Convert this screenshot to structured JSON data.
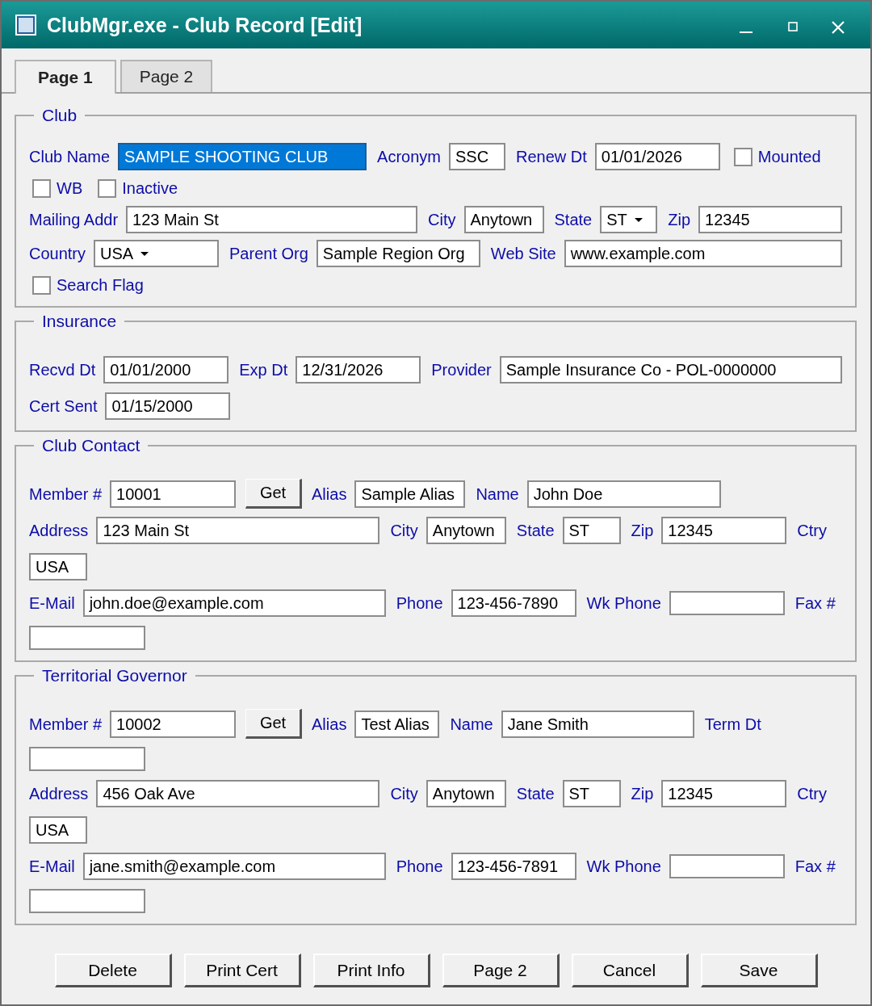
{
  "window": {
    "title": "ClubMgr.exe - Club Record [Edit]"
  },
  "tabs": [
    {
      "label": "Page 1",
      "selected": true
    },
    {
      "label": "Page 2",
      "selected": false
    }
  ],
  "sections": [
    {
      "title": "Club",
      "rows": [
        {
          "items": [
            {
              "kind": "label",
              "text": "Club Name"
            },
            {
              "kind": "field",
              "value": "SAMPLE SHOOTING CLUB",
              "focused": true
            },
            {
              "kind": "label",
              "text": "Acronym"
            },
            {
              "kind": "field",
              "value": "SSC",
              "focused": false
            },
            {
              "kind": "label",
              "text": "Renew Dt"
            },
            {
              "kind": "field",
              "value": "01/01/2026",
              "focused": false
            },
            {
              "kind": "checkbox",
              "label": "Mounted",
              "checked": false
            }
          ]
        },
        {
          "items": [
            {
              "kind": "checkbox",
              "label": "WB",
              "checked": false
            },
            {
              "kind": "checkbox",
              "label": "Inactive",
              "checked": false
            }
          ]
        },
        {
          "items": [
            {
              "kind": "label",
              "text": "Mailing Addr"
            },
            {
              "kind": "field",
              "value": "123 Main St",
              "focused": false
            },
            {
              "kind": "label",
              "text": "City"
            },
            {
              "kind": "field",
              "value": "Anytown",
              "focused": false
            },
            {
              "kind": "label",
              "text": "State"
            },
            {
              "kind": "dropdown",
              "value": "ST",
              "focused": false
            },
            {
              "kind": "label",
              "text": "Zip"
            },
            {
              "kind": "field",
              "value": "12345",
              "focused": false
            }
          ]
        },
        {
          "items": [
            {
              "kind": "label",
              "text": "Country"
            },
            {
              "kind": "dropdown",
              "value": "USA",
              "focused": false
            },
            {
              "kind": "label",
              "text": "Parent Org"
            },
            {
              "kind": "field",
              "value": "Sample Region Org",
              "focused": false
            },
            {
              "kind": "label",
              "text": "Web Site"
            },
            {
              "kind": "field",
              "value": "www.example.com",
              "focused": false
            }
          ]
        },
        {
          "items": [
            {
              "kind": "checkbox",
              "label": "Search Flag",
              "checked": false
            }
          ]
        }
      ]
    },
    {
      "title": "Insurance",
      "rows": [
        {
          "items": [
            {
              "kind": "label",
              "text": "Recvd Dt"
            },
            {
              "kind": "field",
              "value": "01/01/2000",
              "focused": false
            },
            {
              "kind": "label",
              "text": "Exp Dt"
            },
            {
              "kind": "field",
              "value": "12/31/2026",
              "focused": false
            },
            {
              "kind": "label",
              "text": "Provider"
            },
            {
              "kind": "field",
              "value": "Sample Insurance Co - POL-0000000",
              "focused": false
            }
          ]
        },
        {
          "items": [
            {
              "kind": "label",
              "text": "Cert Sent"
            },
            {
              "kind": "field",
              "value": "01/15/2000",
              "focused": false
            }
          ]
        }
      ]
    },
    {
      "title": "Club Contact",
      "rows": [
        {
          "items": [
            {
              "kind": "label",
              "text": "Member #"
            },
            {
              "kind": "field",
              "value": "10001",
              "focused": false
            },
            {
              "kind": "button",
              "label": "Get"
            },
            {
              "kind": "label",
              "text": "Alias"
            },
            {
              "kind": "field",
              "value": "Sample Alias",
              "focused": false
            },
            {
              "kind": "label",
              "text": "Name"
            },
            {
              "kind": "field",
              "value": "John Doe",
              "focused": false
            }
          ]
        },
        {
          "items": [
            {
              "kind": "label",
              "text": "Address"
            },
            {
              "kind": "field",
              "value": "123 Main St",
              "focused": false
            },
            {
              "kind": "label",
              "text": "City"
            },
            {
              "kind": "field",
              "value": "Anytown",
              "focused": false
            },
            {
              "kind": "label",
              "text": "State"
            },
            {
              "kind": "field",
              "value": "ST",
              "focused": false
            },
            {
              "kind": "label",
              "text": "Zip"
            },
            {
              "kind": "field",
              "value": "12345",
              "focused": false
            },
            {
              "kind": "label",
              "text": "Ctry"
            }
          ]
        },
        {
          "items": [
            {
              "kind": "field",
              "value": "USA",
              "focused": false
            }
          ]
        },
        {
          "items": [
            {
              "kind": "label",
              "text": "E-Mail"
            },
            {
              "kind": "field",
              "value": "john.doe@example.com",
              "focused": false
            },
            {
              "kind": "label",
              "text": "Phone"
            },
            {
              "kind": "field",
              "value": "123-456-7890",
              "focused": false
            },
            {
              "kind": "label",
              "text": "Wk Phone"
            },
            {
              "kind": "field",
              "focused": false
            },
            {
              "kind": "label",
              "text": "Fax #"
            }
          ]
        },
        {
          "items": [
            {
              "kind": "field",
              "focused": false
            }
          ]
        }
      ]
    },
    {
      "title": "Territorial Governor",
      "rows": [
        {
          "items": [
            {
              "kind": "label",
              "text": "Member #"
            },
            {
              "kind": "field",
              "value": "10002",
              "focused": false
            },
            {
              "kind": "button",
              "label": "Get"
            },
            {
              "kind": "label",
              "text": "Alias"
            },
            {
              "kind": "field",
              "value": "Test Alias",
              "focused": false
            },
            {
              "kind": "label",
              "text": "Name"
            },
            {
              "kind": "field",
              "value": "Jane Smith",
              "focused": false
            },
            {
              "kind": "label",
              "text": "Term Dt"
            }
          ]
        },
        {
          "items": [
            {
              "kind": "field",
              "focused": false
            }
          ]
        },
        {
          "items": [
            {
              "kind": "label",
              "text": "Address"
            },
            {
              "kind": "field",
              "value": "456 Oak Ave",
              "focused": false
            },
            {
              "kind": "label",
              "text": "City"
            },
            {
              "kind": "field",
              "value": "Anytown",
              "focused": false
            },
            {
              "kind": "label",
              "text": "State"
            },
            {
              "kind": "field",
              "value": "ST",
              "focused": false
            },
            {
              "kind": "label",
              "text": "Zip"
            },
            {
              "kind": "field",
              "value": "12345",
              "focused": false
            },
            {
              "kind": "label",
              "text": "Ctry"
            }
          ]
        },
        {
          "items": [
            {
              "kind": "field",
              "value": "USA",
              "focused": false
            }
          ]
        },
        {
          "items": [
            {
              "kind": "label",
              "text": "E-Mail"
            },
            {
              "kind": "field",
              "value": "jane.smith@example.com",
              "focused": false
            },
            {
              "kind": "label",
              "text": "Phone"
            },
            {
              "kind": "field",
              "value": "123-456-7891",
              "focused": false
            },
            {
              "kind": "label",
              "text": "Wk Phone"
            },
            {
              "kind": "field",
              "focused": false
            },
            {
              "kind": "label",
              "text": "Fax #"
            }
          ]
        },
        {
          "items": [
            {
              "kind": "field",
              "focused": false
            }
          ]
        }
      ]
    }
  ],
  "buttons": [
    "Delete",
    "Print Cert",
    "Print Info",
    "Page 2",
    "Cancel",
    "Save"
  ]
}
